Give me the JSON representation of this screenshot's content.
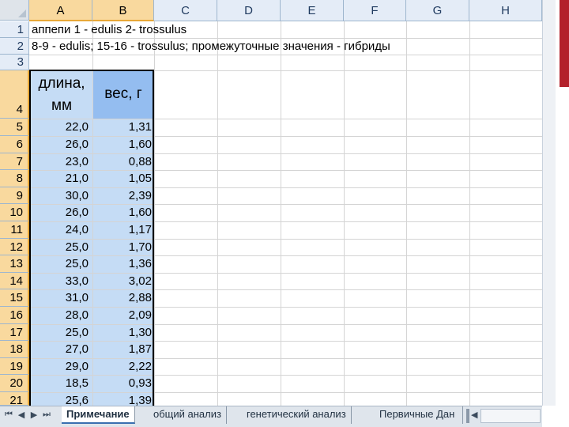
{
  "columns": [
    "A",
    "B",
    "C",
    "D",
    "E",
    "F",
    "G",
    "H"
  ],
  "row_numbers": [
    "1",
    "2",
    "3",
    "4",
    "5",
    "6",
    "7",
    "8",
    "9",
    "10",
    "11",
    "12",
    "13",
    "14",
    "15",
    "16",
    "17",
    "18",
    "19",
    "20",
    "21"
  ],
  "row1_text": "аппепи 1 - edulis 2- trossulus",
  "row2_text": "8-9 - edulis; 15-16 - trossulus; промежуточные значения - гибриды",
  "header_a": "длина, мм",
  "header_b": "вес, г",
  "data_rows": [
    {
      "a": "22,0",
      "b": "1,31"
    },
    {
      "a": "26,0",
      "b": "1,60"
    },
    {
      "a": "23,0",
      "b": "0,88"
    },
    {
      "a": "21,0",
      "b": "1,05"
    },
    {
      "a": "30,0",
      "b": "2,39"
    },
    {
      "a": "26,0",
      "b": "1,60"
    },
    {
      "a": "24,0",
      "b": "1,17"
    },
    {
      "a": "25,0",
      "b": "1,70"
    },
    {
      "a": "25,0",
      "b": "1,36"
    },
    {
      "a": "33,0",
      "b": "3,02"
    },
    {
      "a": "31,0",
      "b": "2,88"
    },
    {
      "a": "28,0",
      "b": "2,09"
    },
    {
      "a": "25,0",
      "b": "1,30"
    },
    {
      "a": "27,0",
      "b": "1,87"
    },
    {
      "a": "29,0",
      "b": "2,22"
    },
    {
      "a": "18,5",
      "b": "0,93"
    },
    {
      "a": "25,6",
      "b": "1,39"
    }
  ],
  "tabs": [
    "Примечание",
    "общий анализ",
    "генетический анализ",
    "Первичные Дан"
  ],
  "active_tab": "Примечание",
  "selected_columns": [
    "A",
    "B"
  ],
  "colors": {
    "selection": "#c5dcf5",
    "header_selected": "#f9d99e",
    "accent_red": "#b3202a"
  }
}
